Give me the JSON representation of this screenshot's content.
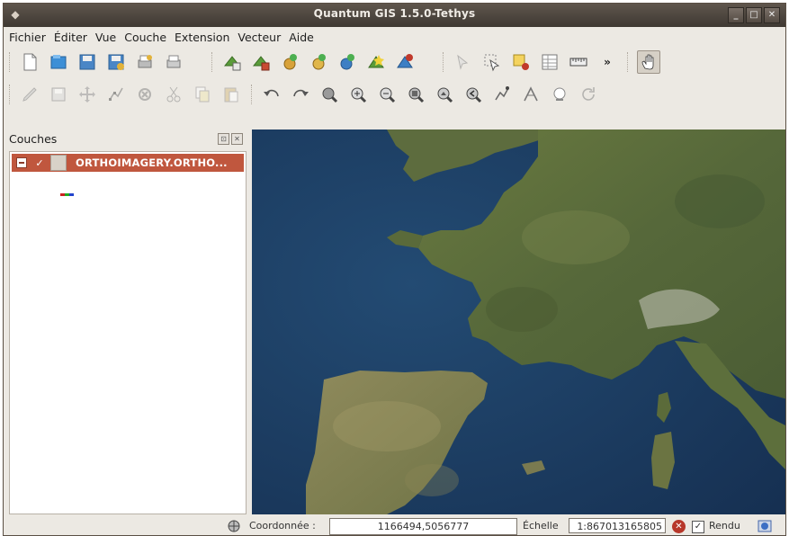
{
  "window": {
    "title": "Quantum GIS 1.5.0-Tethys",
    "min_label": "_",
    "max_label": "□",
    "close_label": "✕"
  },
  "menu": [
    "Fichier",
    "Éditer",
    "Vue",
    "Couche",
    "Extension",
    "Vecteur",
    "Aide"
  ],
  "toolbar1": {
    "icons": [
      "new-project-icon",
      "open-project-icon",
      "save-project-icon",
      "save-as-icon",
      "print-composer-icon",
      "print-icon",
      "add-vector-layer-icon",
      "add-raster-layer-icon",
      "add-postgis-layer-icon",
      "add-spatialite-layer-icon",
      "add-wms-layer-icon",
      "new-vector-layer-icon",
      "remove-layer-icon",
      "identify-icon",
      "select-features-icon",
      "deselect-icon",
      "attribute-table-icon",
      "measure-icon",
      "more-icon",
      "pan-tool-icon"
    ],
    "overflow_label": "»"
  },
  "toolbar2": {
    "icons": [
      "toggle-editing-icon",
      "save-edits-icon",
      "move-feature-icon",
      "node-tool-icon",
      "delete-selected-icon",
      "cut-icon",
      "copy-icon",
      "paste-icon",
      "undo-icon",
      "redo-icon",
      "zoom-full-icon",
      "zoom-in-icon",
      "zoom-out-icon",
      "zoom-layer-icon",
      "zoom-selection-icon",
      "zoom-last-icon",
      "pan-icon",
      "zoom-actual-icon",
      "refresh-icon"
    ]
  },
  "layers_panel": {
    "title": "Couches",
    "float_btn": "⊡",
    "close_btn": "✕",
    "layers": [
      {
        "name": "ORTHOIMAGERY.ORTHO...",
        "visible_mark": "✓"
      }
    ],
    "legend_colors": [
      "#cc2222",
      "#22aa22",
      "#2244cc"
    ]
  },
  "statusbar": {
    "coord_label": "Coordonnée :",
    "coord_value": "1166494,5056777",
    "scale_label": "Échelle",
    "scale_value": "1:867013165805",
    "render_label": "Rendu",
    "render_checked": "✓",
    "stop_mark": "✕"
  },
  "colors": {
    "selection": "#c0573e",
    "sea": "#1c3a5c",
    "land": "#5f6e3a",
    "titlebar": "#4a423b"
  }
}
